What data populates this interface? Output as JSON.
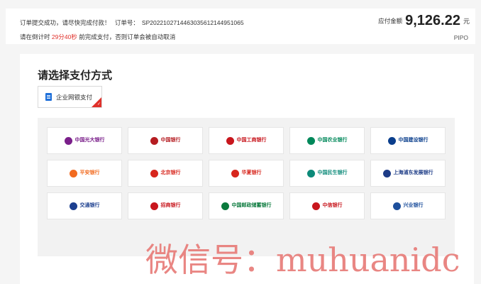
{
  "order": {
    "line1_success": "订单提交成功，请尽快完成付款！",
    "line1_order_label": "订单号：",
    "order_no": "SP20221027144630356121449510​65",
    "line2_prefix": "请在倒计时",
    "countdown": "29分40秒",
    "line2_suffix": "前完成支付，否则订单会被自动取消",
    "amount_label": "应付金额",
    "amount_value": "9,126.22",
    "amount_unit": "元",
    "currency_code": "PIPO"
  },
  "payment": {
    "title": "请选择支付方式",
    "tab_label": "企业网银支付",
    "tab_check": "✓",
    "banks": [
      {
        "label": "中国光大银行",
        "logo_color": "#7a1f8a",
        "text_color": "#7a1f8a"
      },
      {
        "label": "中国银行",
        "logo_color": "#b51c21",
        "text_color": "#b51c21"
      },
      {
        "label": "中国工商银行",
        "logo_color": "#c8161d",
        "text_color": "#c8161d"
      },
      {
        "label": "中国农业银行",
        "logo_color": "#00885a",
        "text_color": "#00885a"
      },
      {
        "label": "中国建设银行",
        "logo_color": "#0a3e8c",
        "text_color": "#0a3e8c"
      },
      {
        "label": "平安银行",
        "logo_color": "#f26b20",
        "text_color": "#f26b20"
      },
      {
        "label": "北京银行",
        "logo_color": "#d7261d",
        "text_color": "#d7261d"
      },
      {
        "label": "华夏银行",
        "logo_color": "#d7261d",
        "text_color": "#d7261d"
      },
      {
        "label": "中国民生银行",
        "logo_color": "#0c8a79",
        "text_color": "#0c8a79"
      },
      {
        "label": "上海浦东发展银行",
        "logo_color": "#1d3c87",
        "text_color": "#1d3c87"
      },
      {
        "label": "交通银行",
        "logo_color": "#1c3f8f",
        "text_color": "#1c3f8f"
      },
      {
        "label": "招商银行",
        "logo_color": "#c8161d",
        "text_color": "#c8161d"
      },
      {
        "label": "中国邮政储蓄银行",
        "logo_color": "#0a7a3d",
        "text_color": "#0a7a3d"
      },
      {
        "label": "中信银行",
        "logo_color": "#c8161d",
        "text_color": "#c8161d"
      },
      {
        "label": "兴业银行",
        "logo_color": "#1d4f9c",
        "text_color": "#1d4f9c"
      }
    ]
  },
  "watermark": {
    "text": "微信号：muhuanidc",
    "color": "#e8807d"
  }
}
